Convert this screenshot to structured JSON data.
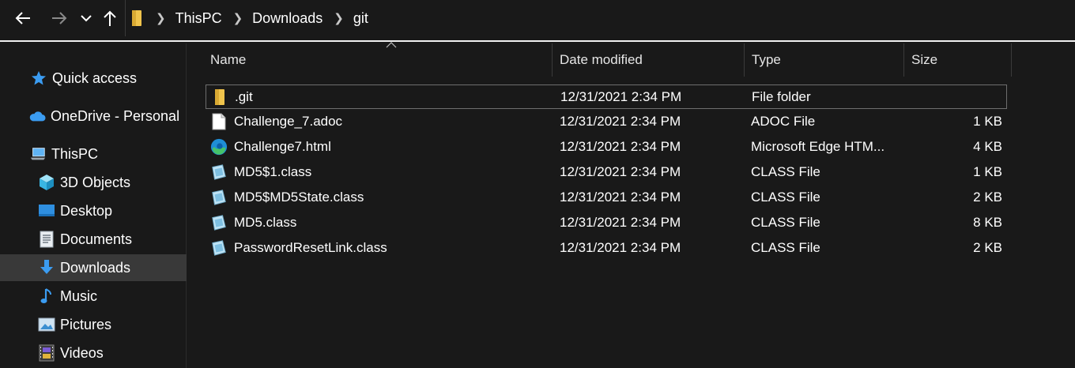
{
  "window": {
    "title": "git"
  },
  "breadcrumb": [
    "ThisPC",
    "Downloads",
    "git"
  ],
  "icons": {
    "back": "back-arrow-icon",
    "forward": "forward-arrow-icon",
    "recent": "chevron-down-icon",
    "up": "up-arrow-icon"
  },
  "colors": {
    "background": "#191919",
    "selected": "#393939",
    "accent_blue": "#3b9cf1",
    "folder_yellow": "#f0c44c"
  },
  "sidebar": {
    "items": [
      {
        "label": "Quick access",
        "icon": "star-icon"
      },
      {
        "label": "OneDrive - Personal",
        "icon": "cloud-icon"
      },
      {
        "label": "ThisPC",
        "icon": "computer-icon"
      },
      {
        "label": "3D Objects",
        "icon": "cube-icon"
      },
      {
        "label": "Desktop",
        "icon": "desktop-icon"
      },
      {
        "label": "Documents",
        "icon": "document-icon"
      },
      {
        "label": "Downloads",
        "icon": "download-icon",
        "selected": true
      },
      {
        "label": "Music",
        "icon": "music-note-icon"
      },
      {
        "label": "Pictures",
        "icon": "pictures-icon"
      },
      {
        "label": "Videos",
        "icon": "film-icon"
      }
    ]
  },
  "columns": {
    "name": "Name",
    "date": "Date modified",
    "type": "Type",
    "size": "Size"
  },
  "files": [
    {
      "name": ".git",
      "date": "12/31/2021 2:34 PM",
      "type": "File folder",
      "size": "",
      "icon": "folder-icon"
    },
    {
      "name": "Challenge_7.adoc",
      "date": "12/31/2021 2:34 PM",
      "type": "ADOC File",
      "size": "1 KB",
      "icon": "blank-file-icon"
    },
    {
      "name": "Challenge7.html",
      "date": "12/31/2021 2:34 PM",
      "type": "Microsoft Edge HTM...",
      "size": "4 KB",
      "icon": "edge-icon"
    },
    {
      "name": "MD5$1.class",
      "date": "12/31/2021 2:34 PM",
      "type": "CLASS File",
      "size": "1 KB",
      "icon": "class-file-icon"
    },
    {
      "name": "MD5$MD5State.class",
      "date": "12/31/2021 2:34 PM",
      "type": "CLASS File",
      "size": "2 KB",
      "icon": "class-file-icon"
    },
    {
      "name": "MD5.class",
      "date": "12/31/2021 2:34 PM",
      "type": "CLASS File",
      "size": "8 KB",
      "icon": "class-file-icon"
    },
    {
      "name": "PasswordResetLink.class",
      "date": "12/31/2021 2:34 PM",
      "type": "CLASS File",
      "size": "2 KB",
      "icon": "class-file-icon"
    }
  ]
}
